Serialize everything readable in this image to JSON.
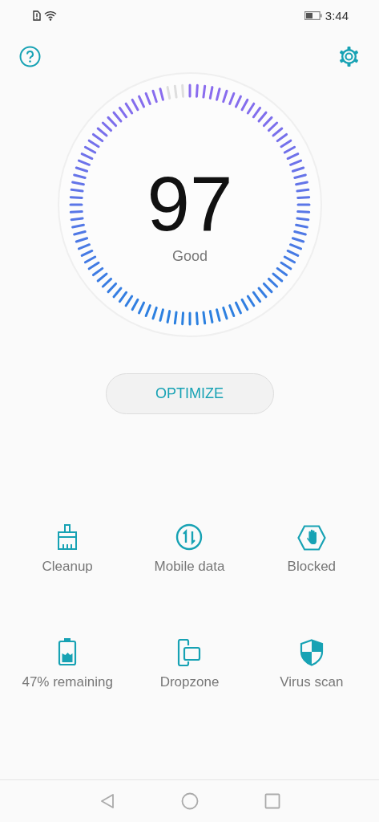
{
  "status_bar": {
    "time": "3:44"
  },
  "score": {
    "value": "97",
    "rating": "Good"
  },
  "optimize_button": "OPTIMIZE",
  "tools": [
    {
      "kind": "cleanup",
      "label": "Cleanup"
    },
    {
      "kind": "data",
      "label": "Mobile data"
    },
    {
      "kind": "blocked",
      "label": "Blocked"
    },
    {
      "kind": "battery",
      "label": "47% remaining"
    },
    {
      "kind": "dropzone",
      "label": "Dropzone"
    },
    {
      "kind": "shield",
      "label": "Virus scan"
    }
  ]
}
